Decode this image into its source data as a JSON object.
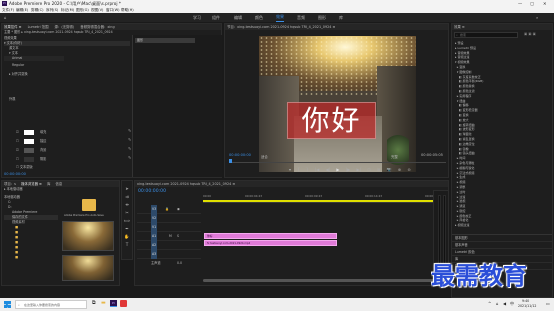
{
  "app": {
    "title": "Adobe Premiere Pro 2020 - C:\\用户\\Mac\\桌面\\s.prproj *"
  },
  "window_controls": [
    "—",
    "▢",
    "✕"
  ],
  "menu": [
    "文件(F)",
    "编辑(E)",
    "剪辑(C)",
    "序列(S)",
    "标记(M)",
    "图形(G)",
    "视图(V)",
    "窗口(W)",
    "帮助(H)"
  ],
  "workspaces": {
    "tabs": [
      "学习",
      "组件",
      "编辑",
      "颜色",
      "效果",
      "音频",
      "图形",
      "库"
    ],
    "active": "效果"
  },
  "effect_controls": {
    "tabs": [
      "效果控件 ≡",
      "Lumetri 范围",
      "源：(无剪辑)",
      "音频剪辑混合器：xing"
    ],
    "source_line": "主要 * 图形 ▸ xing-testsuoyi.com 2021-0924 hqsub TRI_4_2021_0924",
    "clip_badge": "图形",
    "section_video": "视频效果",
    "items": [
      "▾ 文本(你好)",
      "源文本",
      "▾ 文本",
      "Arimai",
      "Regular",
      "▸ 对齐并变换",
      "外观"
    ],
    "appearance": [
      {
        "label": "填充",
        "checked": true
      },
      {
        "label": "描边",
        "checked": false
      },
      {
        "label": "背景",
        "checked": true
      },
      {
        "label": "阴影",
        "checked": false
      },
      {
        "label": "文本蒙版",
        "checked": false
      }
    ],
    "timecode": "00:00:00:00"
  },
  "program_monitor": {
    "title": "节目：xing-testsuoyi.com 2021-0924 hqsub TRI_4_2021_0924 ≡",
    "overlay_text": "你好",
    "timecode_left": "00:00:00:00",
    "fit": "适合",
    "quality": "完整",
    "timecode_right": "00:00:05:05",
    "controls": [
      "▾",
      "{",
      "}",
      "|◀",
      "◀|",
      "▶",
      "|▶",
      "▶|",
      "⊡",
      "⊞",
      "📷",
      "⊕",
      "⊖"
    ]
  },
  "effects_panel": {
    "title": "效果 ≡",
    "search_placeholder": "搜索",
    "tree": [
      "▸ 预设",
      "▸ Lumetri 预设",
      "▸ 音频效果",
      "▸ 音频过渡",
      "▾ 视频效果",
      "  ▸ 变换",
      "  ▾ 图像控制",
      "    ◧ 灰度系数校正",
      "    ◧ 颜色平衡(RGB)",
      "    ◧ 颜色替换",
      "    ◧ 颜色过滤",
      "  ▸ 实用程序",
      "  ▾ 扭曲",
      "    ◧ 偏移",
      "    ◧ 变形稳定器",
      "    ◧ 变换",
      "    ◧ 放大",
      "    ◧ 旋转扭曲",
      "    ◧ 波形变形",
      "    ◧ 球面化",
      "    ◧ 紊乱置换",
      "    ◧ 边角定位",
      "    ◧ 镜像",
      "    ◧ 镜头扭曲",
      "  ▸ 时间",
      "  ▸ 杂色与颗粒",
      "  ▸ 模糊与锐化",
      "  ▸ 沉浸式视频",
      "  ▸ 生成",
      "  ▸ 视频",
      "  ▸ 调整",
      "  ▸ 过时",
      "  ▸ 过渡",
      "  ▸ 透视",
      "  ▸ 通道",
      "  ▸ 键控",
      "  ▸ 颜色校正",
      "  ▸ 风格化",
      "▸ 视频过渡"
    ],
    "bottom": [
      "基本图形",
      "基本声音",
      "Lumetri 颜色",
      "库",
      "标记",
      "历史记录"
    ]
  },
  "project_panel": {
    "tabs": [
      "项目：s",
      "媒体浏览器 ≡",
      "库",
      "信息"
    ],
    "breadcrumb": "▸ 本地驱动器",
    "folders": [
      "本地驱动器",
      "C:",
      "D:",
      "Adobe Premiere",
      "保存的文件",
      "视频素材"
    ],
    "thumb_label": "Adobe Premiere Pro Auto-Save"
  },
  "timeline": {
    "tab": "xing-testsuoyi.com 2021-0924 hqsub TRI_4_2021_0924 ≡",
    "timecode": "00:00:00:00",
    "ruler": [
      "00:00",
      "00:00:04:23",
      "00:00:09:23",
      "00:00:14:23",
      "00:00:19:23"
    ],
    "tracks": [
      "V3",
      "V2",
      "V1",
      "A1",
      "A2",
      "A3"
    ],
    "clip_top": "你好",
    "clip_bottom": "fx testsuoyi.com-2021-0924.mp4",
    "master": "主声道",
    "master_value": "0.0"
  },
  "watermark": "最需教育",
  "taskbar": {
    "search_placeholder": "在这里输入你要搜索的内容",
    "time": "9:40",
    "date": "2021/11/12",
    "lang": "中"
  }
}
